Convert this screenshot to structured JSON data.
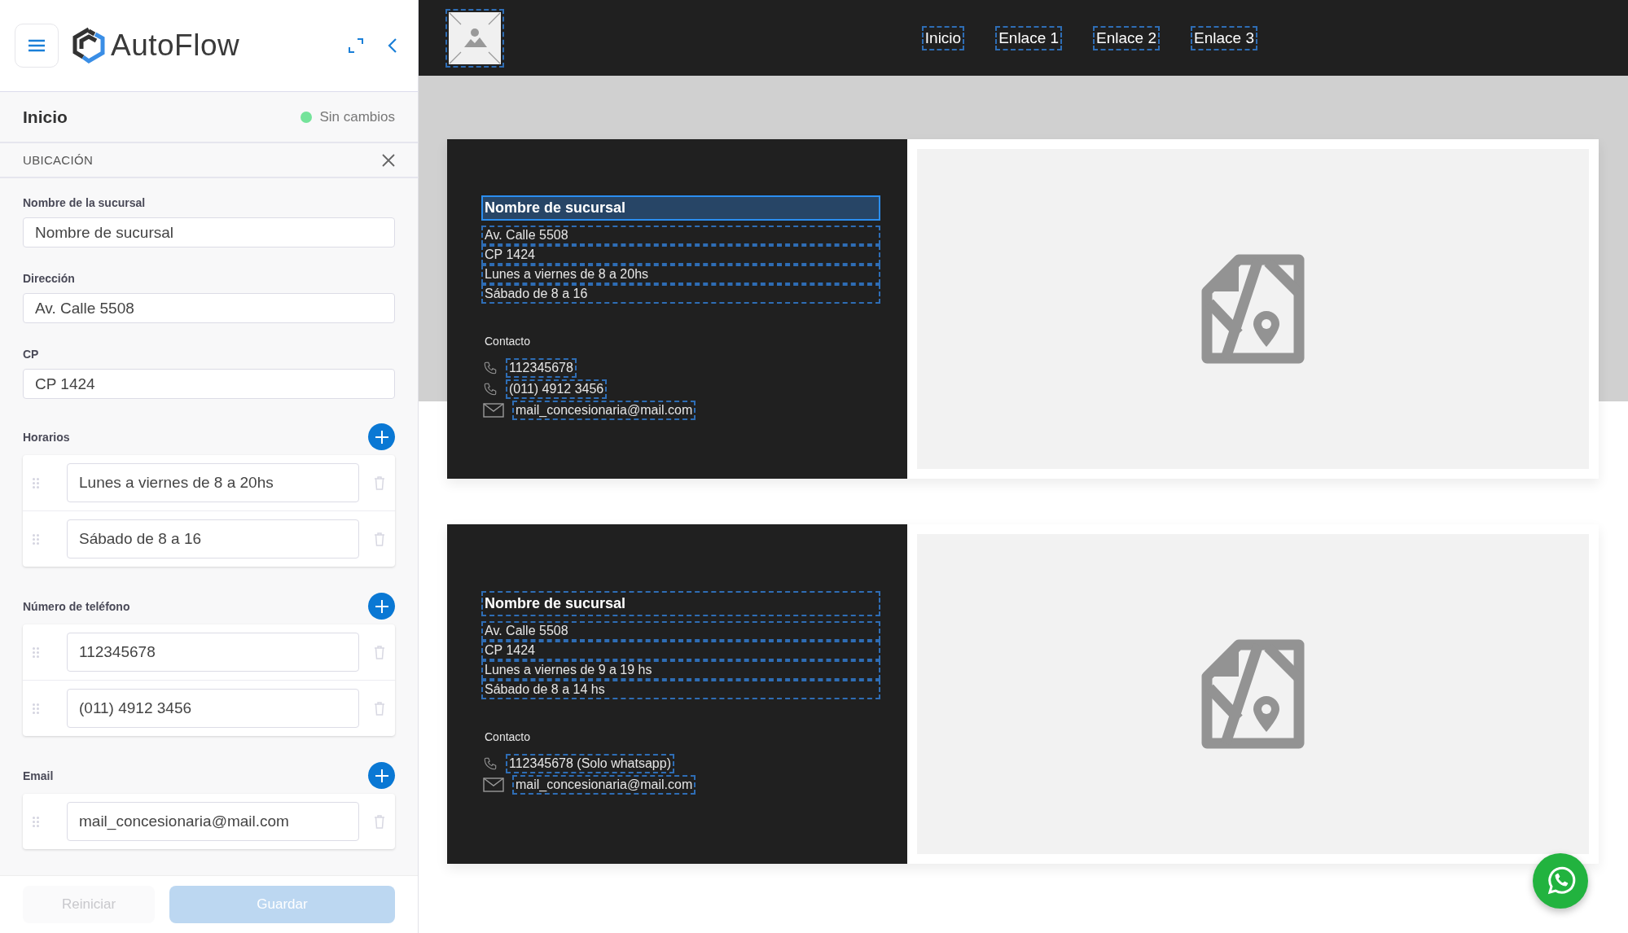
{
  "sidebar": {
    "brand": "AutoFlow",
    "page_title": "Inicio",
    "status": "Sin cambios",
    "section": "UBICACIÓN",
    "fields": [
      {
        "label": "Nombre de la sucursal",
        "value": "Nombre de sucursal"
      },
      {
        "label": "Dirección",
        "value": "Av. Calle 5508"
      },
      {
        "label": "CP",
        "value": "CP 1424"
      }
    ],
    "lists": [
      {
        "label": "Horarios",
        "items": [
          "Lunes a viernes de 8 a 20hs",
          "Sábado de 8 a 16"
        ]
      },
      {
        "label": "Número de teléfono",
        "items": [
          "112345678",
          "(011) 4912 3456"
        ]
      },
      {
        "label": "Email",
        "items": [
          "mail_concesionaria@mail.com"
        ]
      }
    ],
    "buttons": [
      {
        "label": "Reiniciar",
        "kind": "secondary",
        "disabled": true
      },
      {
        "label": "Guardar",
        "kind": "primary",
        "disabled": true
      }
    ]
  },
  "preview": {
    "nav": [
      "Inicio",
      "Enlace 1",
      "Enlace 2",
      "Enlace 3"
    ],
    "branches": [
      {
        "name": "Nombre de sucursal",
        "selected": true,
        "lines": [
          "Av. Calle 5508",
          "CP 1424",
          "Lunes a viernes de 8 a 20hs",
          "Sábado de 8 a 16"
        ],
        "contact_label": "Contacto",
        "contacts": [
          {
            "kind": "phone",
            "text": "112345678"
          },
          {
            "kind": "phone",
            "text": "(011) 4912 3456"
          },
          {
            "kind": "email",
            "text": "mail_concesionaria@mail.com"
          }
        ]
      },
      {
        "name": "Nombre de sucursal",
        "selected": false,
        "lines": [
          "Av. Calle 5508",
          "CP 1424",
          "Lunes a viernes de 9 a 19 hs",
          "Sábado de 8 a 14 hs"
        ],
        "contact_label": "Contacto",
        "contacts": [
          {
            "kind": "phone",
            "text": "112345678 (Solo whatsapp)"
          },
          {
            "kind": "email",
            "text": "mail_concesionaria@mail.com"
          }
        ]
      }
    ]
  }
}
